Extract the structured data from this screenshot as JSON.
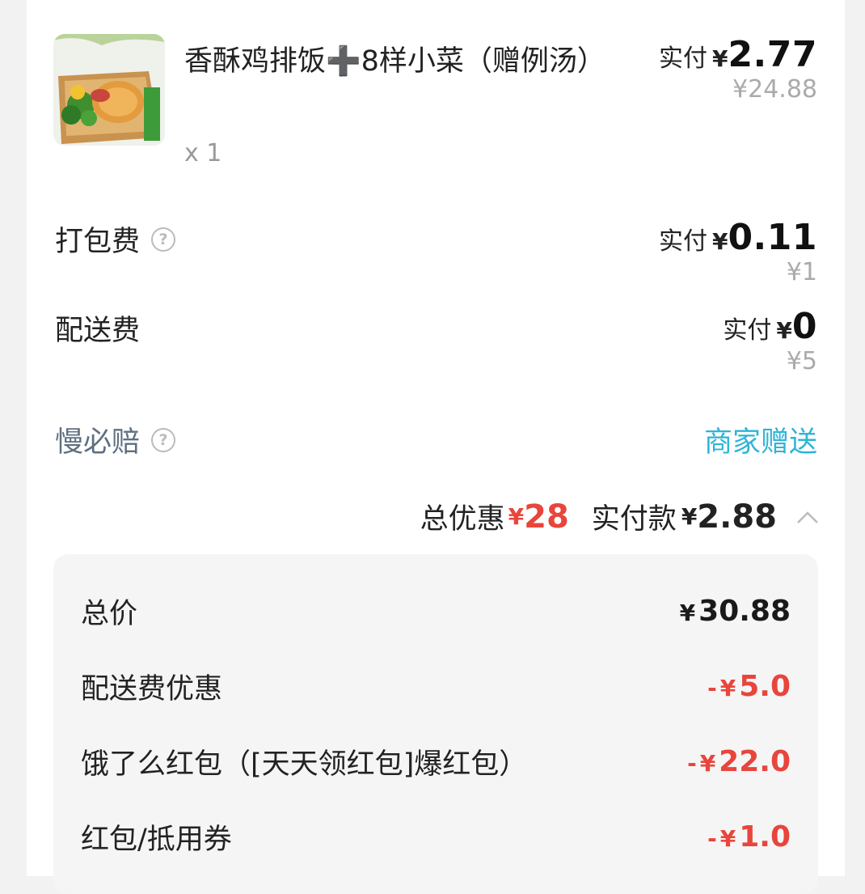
{
  "product": {
    "name": "香酥鸡排饭➕8样小菜（赠例汤）",
    "qty": "x 1",
    "pay_label": "实付",
    "currency": "¥",
    "pay_value": "2.77",
    "original_price": "¥24.88"
  },
  "packing": {
    "label": "打包费",
    "pay_label": "实付",
    "currency": "¥",
    "pay_value": "0.11",
    "original_price": "¥1"
  },
  "delivery": {
    "label": "配送费",
    "pay_label": "实付",
    "currency": "¥",
    "pay_value": "0",
    "original_price": "¥5"
  },
  "late_compensation": {
    "label": "慢必赔",
    "gift": "商家赠送"
  },
  "summary": {
    "discount_label": "总优惠",
    "discount_currency": "¥",
    "discount_value": "28",
    "paid_label": "实付款",
    "paid_currency": "¥",
    "paid_value": "2.88"
  },
  "details": [
    {
      "label": "总价",
      "sign": "",
      "currency": "¥",
      "value": "30.88"
    },
    {
      "label": "配送费优惠",
      "sign": "-",
      "currency": "¥",
      "value": "5.0"
    },
    {
      "label": "饿了么红包（[天天领红包]爆红包）",
      "sign": "-",
      "currency": "¥",
      "value": "22.0"
    },
    {
      "label": "红包/抵用券",
      "sign": "-",
      "currency": "¥",
      "value": "1.0"
    }
  ],
  "colors": {
    "accent_red": "#e8453c",
    "accent_blue": "#2fb4d8"
  },
  "icons": [
    "help-circle-icon",
    "chevron-up-icon"
  ]
}
